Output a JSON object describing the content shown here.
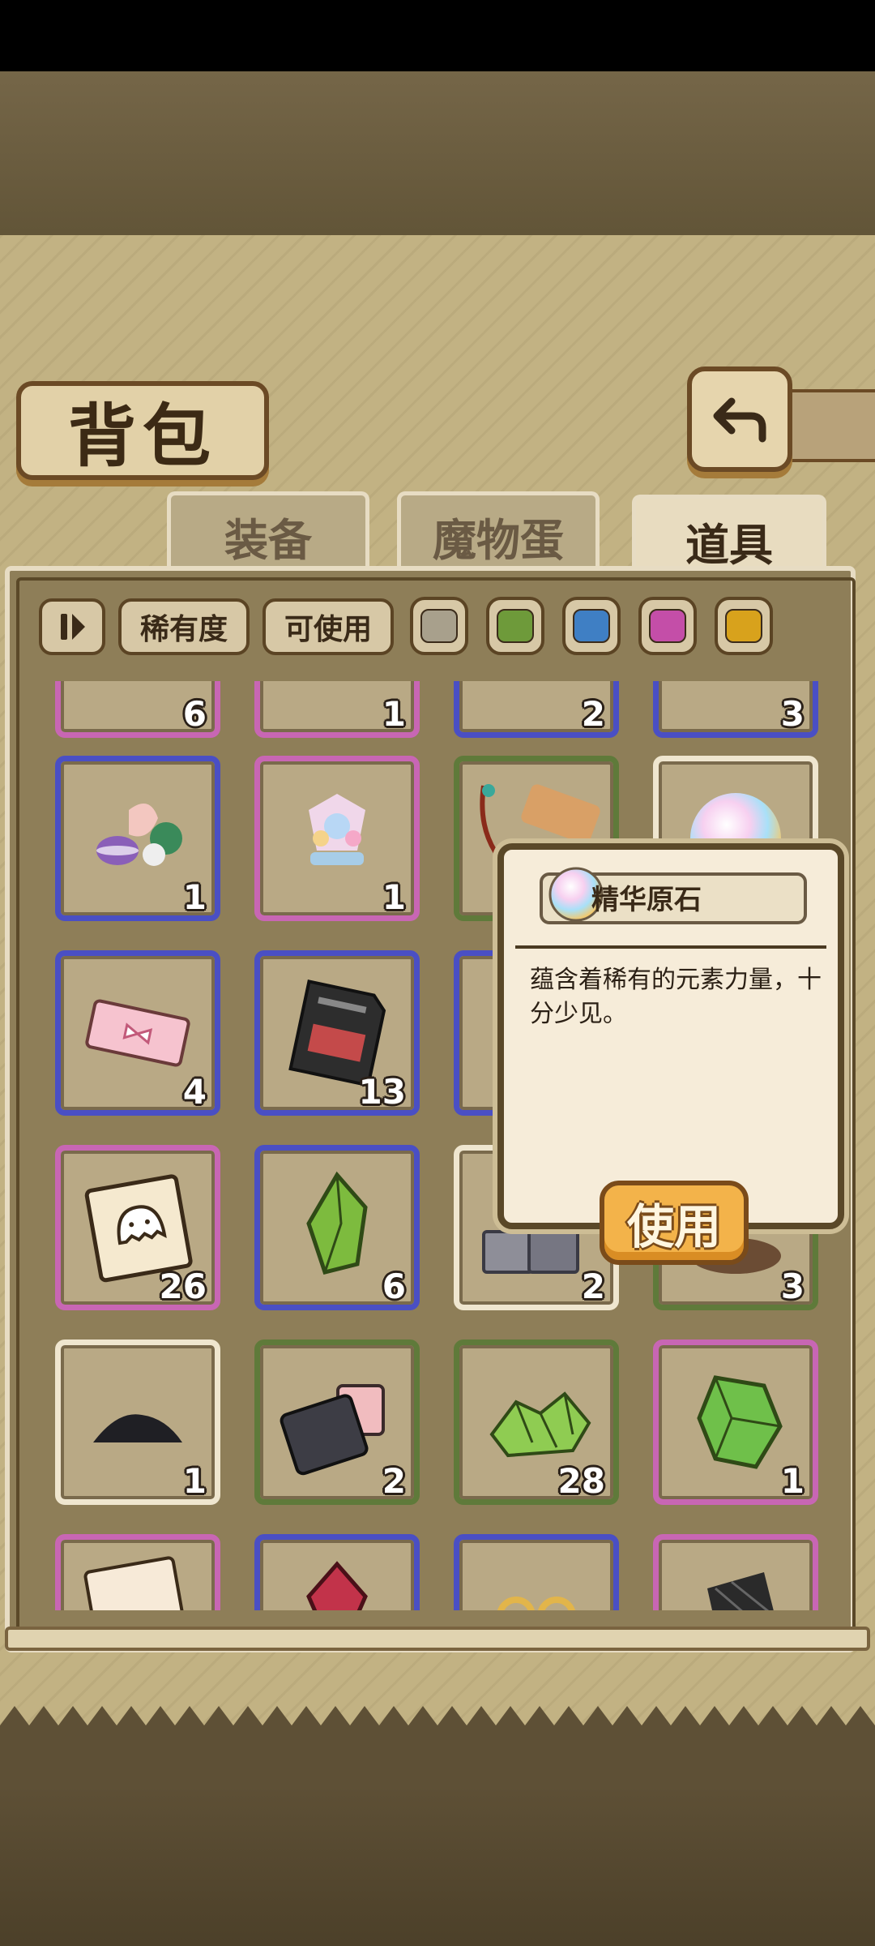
{
  "header": {
    "title": "背包",
    "back_icon": "back-arrow-icon"
  },
  "tabs": [
    {
      "label": "装备",
      "active": false
    },
    {
      "label": "魔物蛋",
      "active": false
    },
    {
      "label": "道具",
      "active": true
    }
  ],
  "filters": {
    "toggle_icon": "pause-toggle-icon",
    "rarity_label": "稀有度",
    "usable_label": "可使用",
    "swatches": [
      {
        "name": "gray",
        "color": "#a8a08c"
      },
      {
        "name": "green",
        "color": "#6e9a3a"
      },
      {
        "name": "blue",
        "color": "#3f7fc4"
      },
      {
        "name": "pink",
        "color": "#c44ea8"
      },
      {
        "name": "gold",
        "color": "#d8a21c"
      }
    ]
  },
  "inventory": {
    "row0": [
      {
        "count": "6",
        "rarity": "pink",
        "icon": "partial-item-icon"
      },
      {
        "count": "1",
        "rarity": "pink",
        "icon": "partial-item-icon"
      },
      {
        "count": "2",
        "rarity": "blue",
        "icon": "partial-item-icon"
      },
      {
        "count": "3",
        "rarity": "blue",
        "icon": "partial-item-icon"
      }
    ],
    "row1": [
      {
        "count": "1",
        "rarity": "blue",
        "icon": "candy-shells-icon"
      },
      {
        "count": "1",
        "rarity": "pink",
        "icon": "crystal-flower-icon"
      },
      {
        "count": "",
        "rarity": "green",
        "icon": "wooden-tag-icon"
      },
      {
        "count": "",
        "rarity": "white",
        "icon": "rainbow-orb-icon"
      }
    ],
    "row2": [
      {
        "count": "4",
        "rarity": "blue",
        "icon": "pink-ticket-icon"
      },
      {
        "count": "13",
        "rarity": "blue",
        "icon": "sd-card-icon"
      },
      {
        "count": "",
        "rarity": "blue",
        "icon": "hidden-item-icon"
      },
      {
        "count": "",
        "rarity": "white",
        "icon": "hidden-item-icon"
      }
    ],
    "row3": [
      {
        "count": "26",
        "rarity": "pink",
        "icon": "ghost-photo-icon"
      },
      {
        "count": "6",
        "rarity": "blue",
        "icon": "green-crystal-icon"
      },
      {
        "count": "2",
        "rarity": "white",
        "icon": "stone-blocks-icon"
      },
      {
        "count": "3",
        "rarity": "green",
        "icon": "leather-item-icon"
      }
    ],
    "row4": [
      {
        "count": "1",
        "rarity": "white",
        "icon": "black-sand-icon"
      },
      {
        "count": "2",
        "rarity": "green",
        "icon": "compact-case-icon"
      },
      {
        "count": "28",
        "rarity": "green",
        "icon": "green-shards-icon"
      },
      {
        "count": "1",
        "rarity": "pink",
        "icon": "green-gem-icon"
      }
    ],
    "row5": [
      {
        "count": "",
        "rarity": "pink",
        "icon": "character-card-icon"
      },
      {
        "count": "",
        "rarity": "blue",
        "icon": "red-crystal-icon"
      },
      {
        "count": "",
        "rarity": "blue",
        "icon": "gold-rings-icon"
      },
      {
        "count": "",
        "rarity": "pink",
        "icon": "net-glove-icon"
      }
    ]
  },
  "popup": {
    "item_name": "精华原石",
    "item_icon": "rainbow-orb-icon",
    "description": "蕴含着稀有的元素力量，十分少见。",
    "use_label": "使用"
  }
}
